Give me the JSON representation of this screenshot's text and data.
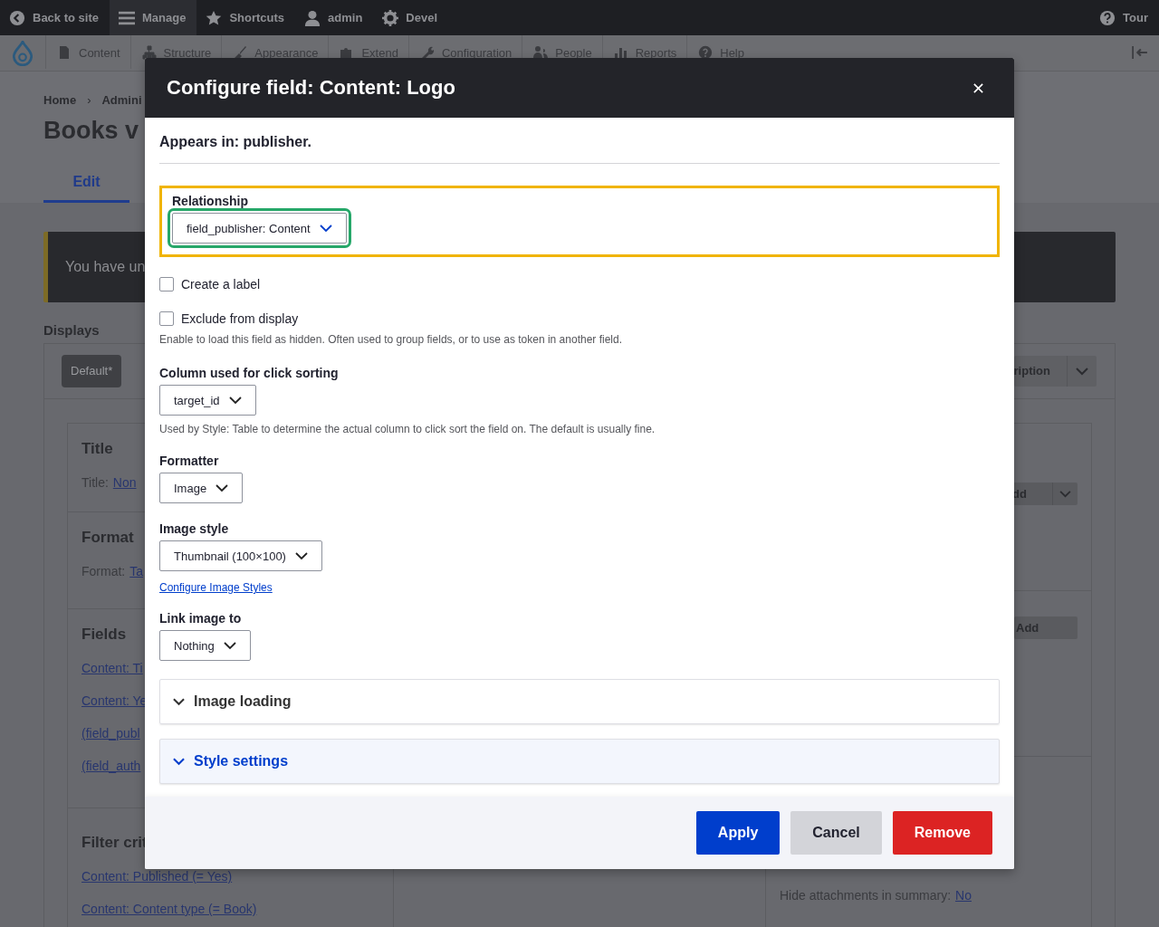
{
  "toolbar": {
    "items": [
      {
        "label": "Back to site",
        "kind": "back",
        "selected": false
      },
      {
        "label": "Manage",
        "kind": "menu",
        "selected": true
      },
      {
        "label": "Shortcuts",
        "kind": "star",
        "selected": false
      },
      {
        "label": "admin",
        "kind": "user",
        "selected": false
      },
      {
        "label": "Devel",
        "kind": "gear",
        "selected": false
      }
    ],
    "tour": "Tour"
  },
  "admin_menu": {
    "items": [
      {
        "label": "Content",
        "kind": "doc"
      },
      {
        "label": "Structure",
        "kind": "structure"
      },
      {
        "label": "Appearance",
        "kind": "brush"
      },
      {
        "label": "Extend",
        "kind": "puzzle"
      },
      {
        "label": "Configuration",
        "kind": "wrench"
      },
      {
        "label": "People",
        "kind": "people"
      },
      {
        "label": "Reports",
        "kind": "bars"
      },
      {
        "label": "Help",
        "kind": "help"
      }
    ]
  },
  "breadcrumb": {
    "items": [
      "Home",
      "Admini"
    ],
    "separator": "›"
  },
  "page_title": "Books v",
  "tabs": [
    {
      "label": "Edit",
      "selected": true
    }
  ],
  "message": "You have un",
  "displays": {
    "heading": "Displays",
    "left_button": "Default*",
    "right_button": "ription"
  },
  "left_sections": [
    {
      "heading": "Title",
      "items": [
        {
          "label": "Title:",
          "link": "Non"
        }
      ]
    },
    {
      "heading": "Format",
      "items": [
        {
          "label": "Format:",
          "link": "Ta"
        }
      ]
    },
    {
      "heading": "Fields",
      "items": [
        {
          "link": "Content: Ti"
        },
        {
          "link": "Content: Ye"
        },
        {
          "link": "(field_publ"
        },
        {
          "link": "(field_auth"
        }
      ]
    },
    {
      "heading": "Filter crit",
      "items": [
        {
          "link": "Content: Published (= Yes)"
        },
        {
          "link": "Content: Content type (= Book)"
        }
      ]
    }
  ],
  "right_sections": [
    {
      "kind": "button",
      "label": "dd",
      "dropdown": true
    },
    {
      "kind": "button",
      "label": "Add",
      "dropdown": false
    },
    {
      "kind": "setting",
      "label": "Hide attachments in summary:",
      "link": "No"
    }
  ],
  "modal": {
    "title": "Configure field: Content: Logo",
    "appears_in": "Appears in: publisher.",
    "form": [
      {
        "kind": "select",
        "label": "Relationship",
        "value": "field_publisher: Content",
        "highlighted": true,
        "focused": true
      },
      {
        "kind": "checkbox",
        "label": "Create a label",
        "checked": false
      },
      {
        "kind": "checkbox",
        "label": "Exclude from display",
        "checked": false,
        "description": "Enable to load this field as hidden. Often used to group fields, or to use as token in another field."
      },
      {
        "kind": "select",
        "label": "Column used for click sorting",
        "value": "target_id",
        "highlighted": false,
        "focused": false,
        "description": "Used by Style: Table to determine the actual column to click sort the field on. The default is usually fine."
      },
      {
        "kind": "select",
        "label": "Formatter",
        "value": "Image",
        "highlighted": false,
        "focused": false
      },
      {
        "kind": "select",
        "label": "Image style",
        "value": "Thumbnail (100×100)",
        "highlighted": false,
        "focused": false
      },
      {
        "kind": "link",
        "label": "Configure Image Styles"
      },
      {
        "kind": "select",
        "label": "Link image to",
        "value": "Nothing",
        "highlighted": false,
        "focused": false
      },
      {
        "kind": "details",
        "label": "Image loading",
        "highlighted": false
      },
      {
        "kind": "details",
        "label": "Style settings",
        "highlighted": true
      }
    ],
    "buttons": [
      {
        "label": "Apply",
        "kind": "primary"
      },
      {
        "label": "Cancel",
        "kind": "secondary"
      },
      {
        "label": "Remove",
        "kind": "danger"
      }
    ]
  }
}
